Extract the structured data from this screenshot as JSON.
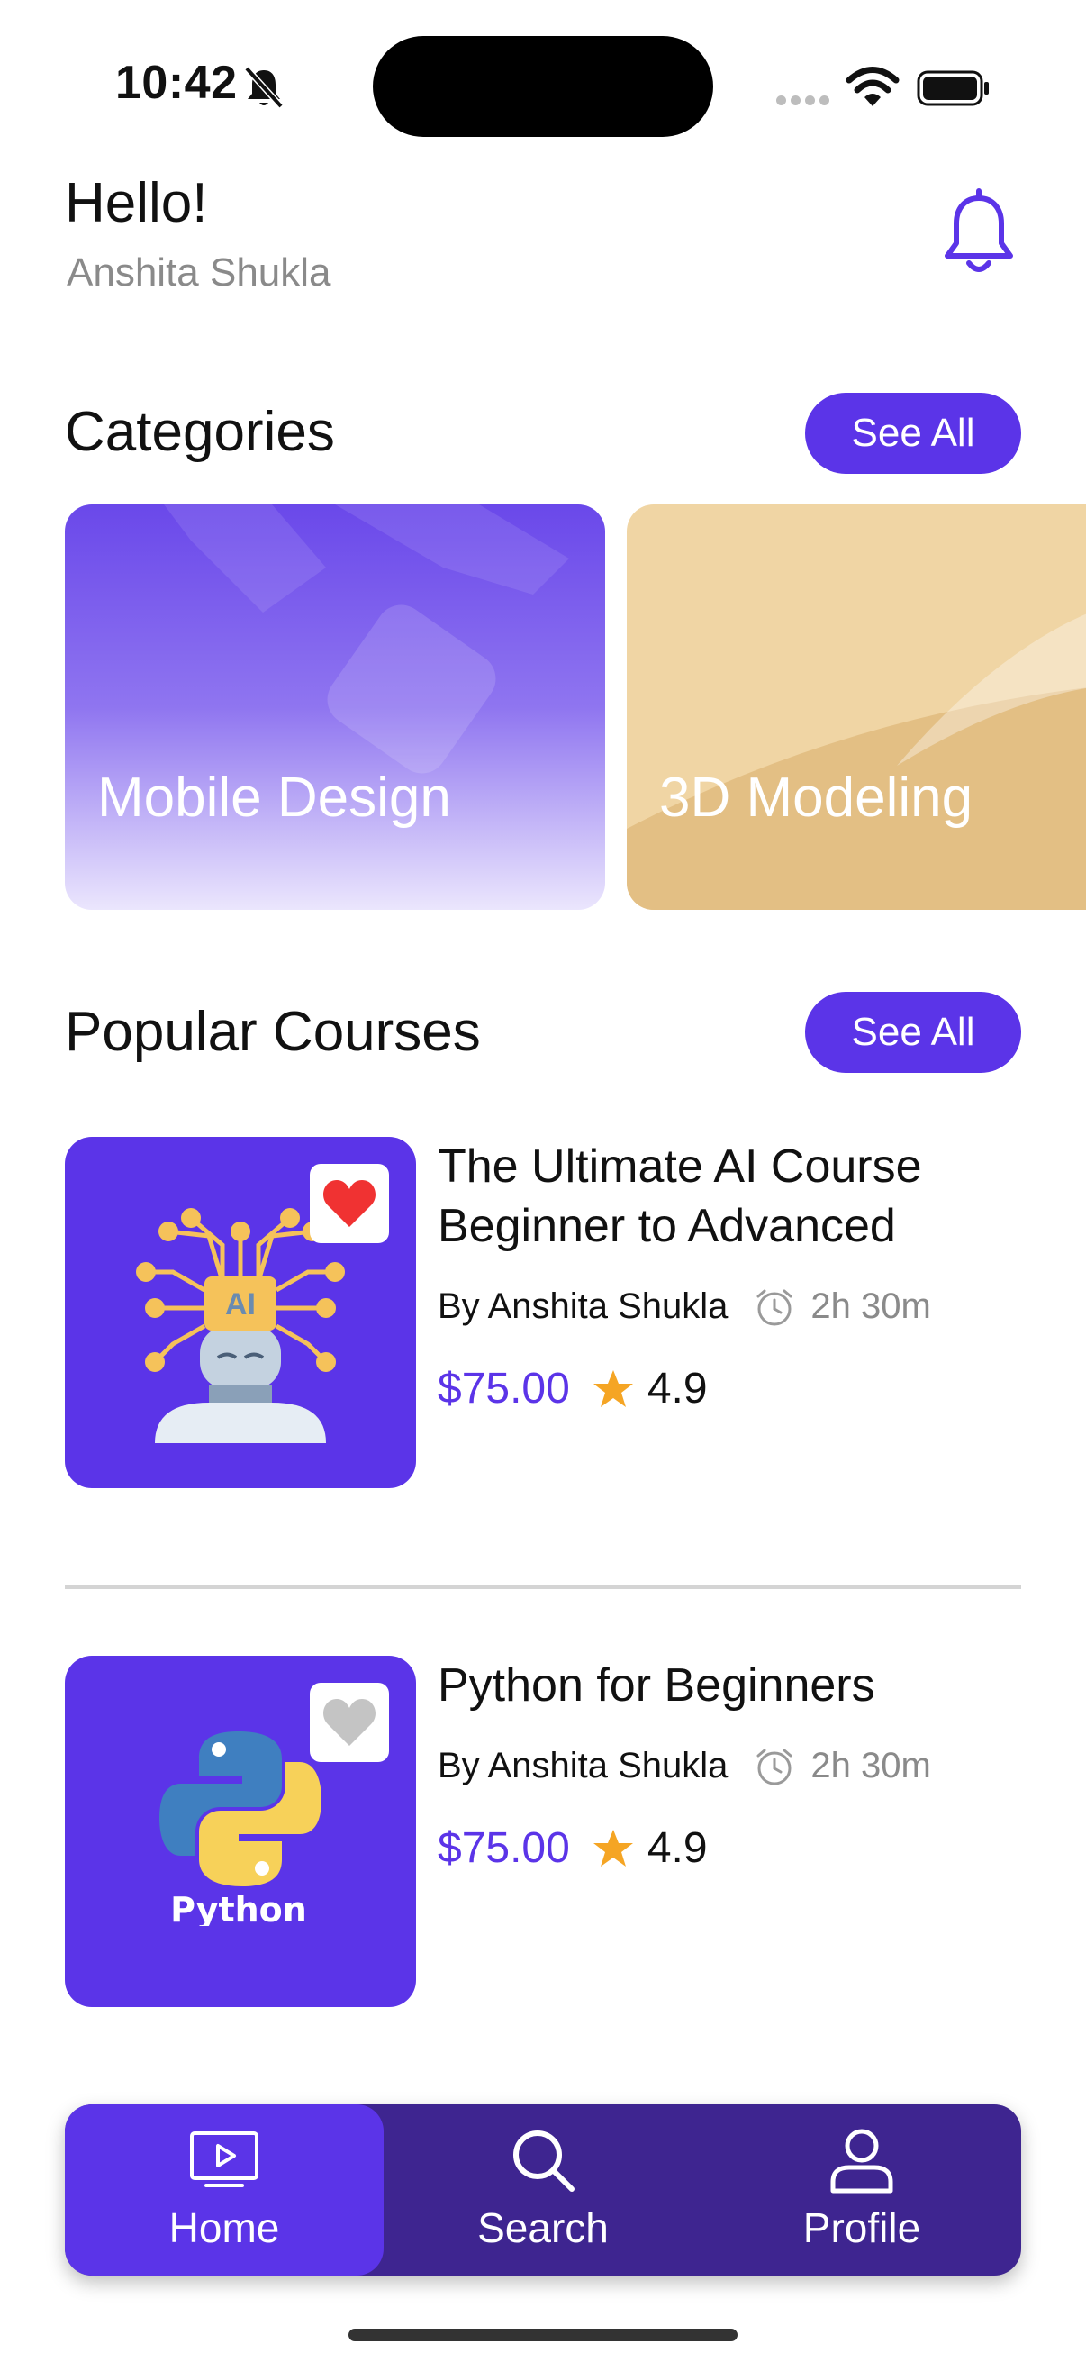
{
  "status_bar": {
    "time": "10:42"
  },
  "header": {
    "greeting": "Hello!",
    "username": "Anshita Shukla"
  },
  "categories": {
    "title": "Categories",
    "see_all_label": "See All",
    "items": [
      {
        "label": "Mobile Design"
      },
      {
        "label": "3D Modeling"
      }
    ]
  },
  "popular_courses": {
    "title": "Popular Courses",
    "see_all_label": "See All",
    "items": [
      {
        "title": "The Ultimate AI Course Beginner to Advanced",
        "author": "By Anshita Shukla",
        "duration": "2h 30m",
        "price": "$75.00",
        "rating": "4.9",
        "favorited": true,
        "thumb_badge": "AI"
      },
      {
        "title": "Python for Beginners",
        "author": "By Anshita Shukla",
        "duration": "2h 30m",
        "price": "$75.00",
        "rating": "4.9",
        "favorited": false,
        "thumb_badge": "Python"
      }
    ]
  },
  "bottom_nav": {
    "tabs": [
      {
        "label": "Home",
        "icon": "tv-play-icon",
        "active": true
      },
      {
        "label": "Search",
        "icon": "search-icon",
        "active": false
      },
      {
        "label": "Profile",
        "icon": "user-icon",
        "active": false
      }
    ]
  },
  "colors": {
    "accent": "#5b34e8",
    "tabbar": "#3e2590",
    "favorite_red": "#f03232",
    "star": "#f5a524",
    "category_3d": "#f0d5a4"
  }
}
